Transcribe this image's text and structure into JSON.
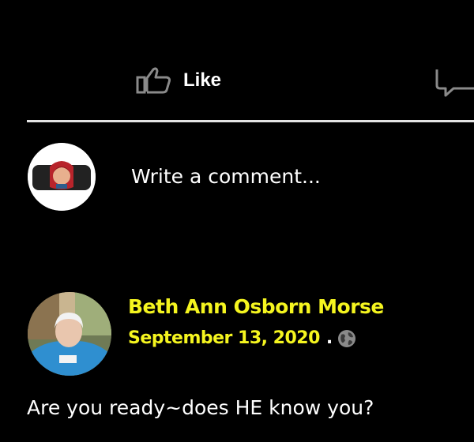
{
  "actions": {
    "like_label": "Like",
    "like_icon": "thumbs-up-icon",
    "comment_icon": "comment-bubble-icon"
  },
  "composer": {
    "placeholder": "Write a comment...",
    "avatar_icon": "user-avatar"
  },
  "post": {
    "author": "Beth Ann Osborn Morse",
    "date": "September 13, 2020",
    "separator": ".",
    "privacy_icon": "globe-icon",
    "text": "Are you ready~does HE know you?"
  },
  "colors": {
    "background": "#000000",
    "text": "#ffffff",
    "highlight": "#f5f51f",
    "divider": "#e4e4e4"
  }
}
